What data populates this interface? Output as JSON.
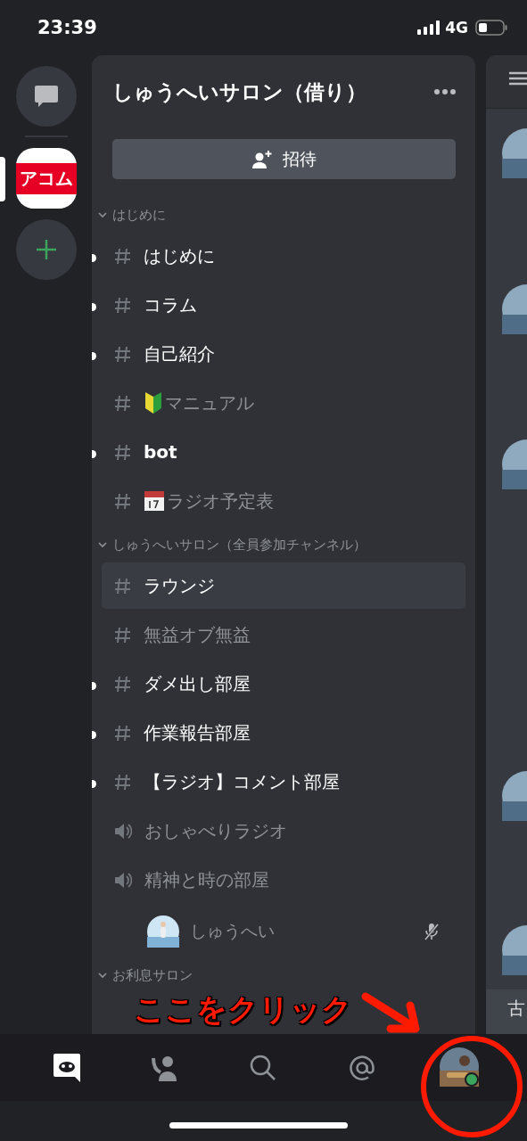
{
  "status_bar": {
    "time": "23:39",
    "network": "4G"
  },
  "servers": [
    {
      "kind": "dm",
      "selected": false
    },
    {
      "kind": "server",
      "label": "アコム",
      "selected": true
    },
    {
      "kind": "add",
      "selected": false
    }
  ],
  "server_name": "しゅうへいサロン（借り）",
  "invite_button": "招待",
  "channels": [
    {
      "kind": "category",
      "name": "はじめに",
      "expanded": true
    },
    {
      "kind": "text",
      "name": "はじめに",
      "unread": true,
      "selected": false
    },
    {
      "kind": "text",
      "name": "コラム",
      "unread": true,
      "selected": false
    },
    {
      "kind": "text",
      "name": "自己紹介",
      "unread": true,
      "selected": false
    },
    {
      "kind": "beginner",
      "name": "マニュアル",
      "unread": false,
      "selected": false
    },
    {
      "kind": "text",
      "name": "bot",
      "unread": true,
      "selected": false
    },
    {
      "kind": "calendar",
      "name": "ラジオ予定表",
      "unread": false,
      "selected": false
    },
    {
      "kind": "category",
      "name": "しゅうへいサロン（全員参加チャンネル）",
      "expanded": true
    },
    {
      "kind": "text",
      "name": "ラウンジ",
      "unread": false,
      "selected": true
    },
    {
      "kind": "text",
      "name": "無益オブ無益",
      "unread": false,
      "selected": false
    },
    {
      "kind": "text",
      "name": "ダメ出し部屋",
      "unread": true,
      "selected": false
    },
    {
      "kind": "text",
      "name": "作業報告部屋",
      "unread": true,
      "selected": false
    },
    {
      "kind": "text",
      "name": "【ラジオ】コメント部屋",
      "unread": true,
      "selected": false
    },
    {
      "kind": "voice",
      "name": "おしゃべりラジオ",
      "unread": false,
      "selected": false
    },
    {
      "kind": "voice",
      "name": "精神と時の部屋",
      "unread": false,
      "selected": false
    },
    {
      "kind": "user",
      "name": "しゅうへい",
      "muted": true
    },
    {
      "kind": "category",
      "name": "お利息サロン",
      "expanded": true
    }
  ],
  "chat_peek": {
    "text": "古"
  },
  "nav_tabs": [
    {
      "kind": "home",
      "selected": true
    },
    {
      "kind": "friends",
      "selected": false
    },
    {
      "kind": "search",
      "selected": false
    },
    {
      "kind": "mentions",
      "selected": false
    },
    {
      "kind": "profile",
      "selected": false
    }
  ],
  "annotation": {
    "text": "ここをクリック"
  }
}
